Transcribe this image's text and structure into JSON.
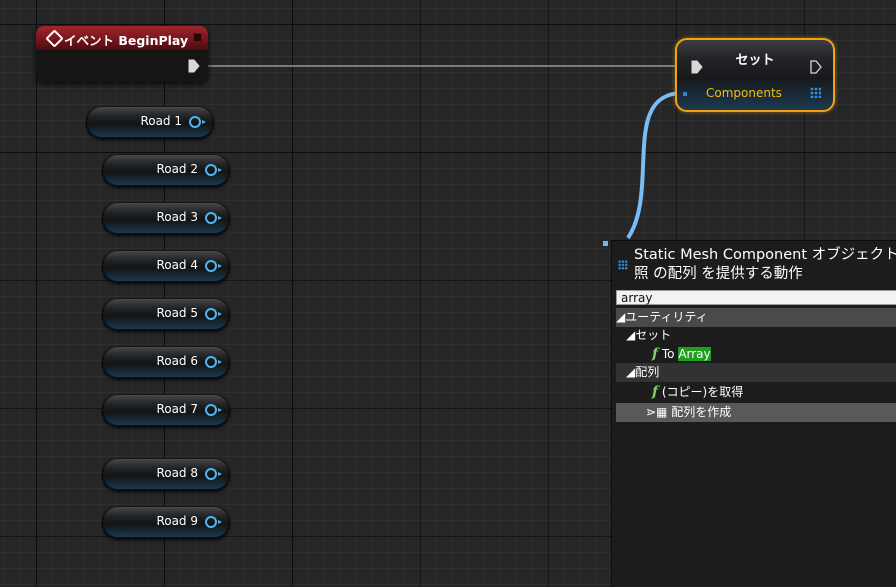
{
  "event_node": {
    "title": "イベント BeginPlay"
  },
  "variables": [
    {
      "label": "Road 1"
    },
    {
      "label": "Road 2"
    },
    {
      "label": "Road 3"
    },
    {
      "label": "Road 4"
    },
    {
      "label": "Road 5"
    },
    {
      "label": "Road 6"
    },
    {
      "label": "Road 7"
    },
    {
      "label": "Road 8"
    },
    {
      "label": "Road 9"
    }
  ],
  "set_node": {
    "title": "セット",
    "pin_label": "Components"
  },
  "context_menu": {
    "header": "Static Mesh Component オブジェクト参\n照 の配列 を提供する動作",
    "search_value": "array",
    "items": {
      "category_utility": "ユーティリティ",
      "sub_set": "セット",
      "to_prefix": "To ",
      "to_match": "Array",
      "sub_array": "配列",
      "get_copy": "(コピー)を取得",
      "make_array": "配列を作成"
    }
  },
  "colors": {
    "accent_selected": "#f0a313",
    "object_pin": "#4fb6f2",
    "event_header": "#a1262e",
    "search_match": "#1f9d1f"
  }
}
